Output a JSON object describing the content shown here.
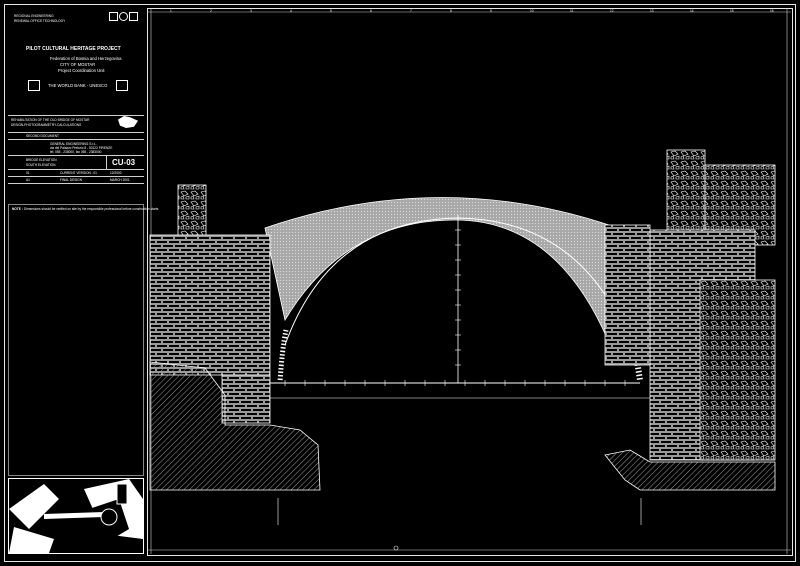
{
  "title_block": {
    "org_small_1": "REGIONAL ENGINEERING",
    "org_small_2": "RENEWAL OFFICE TECHNOLOGY",
    "project_title": "PILOT CULTURAL HERITAGE PROJECT",
    "federation": "Federation of Bosnia and Herzegovina",
    "city": "CITY OF MOSTAR",
    "unit": "Project Coordination Unit",
    "sponsor": "THE WORLD BANK - UNESCO",
    "rehab_line1": "REHABILITATION OF THE OLD BRIDGE OF MOSTAR",
    "rehab_line2": "DESIGN-PHOTOGRAMMETRY-CALCULATIONS",
    "second_document": "SECOND DOCUMENT",
    "engineer_line1": "GENERAL ENGINEERING S.r.L.",
    "engineer_line2": "via del Palazzo Pretorio 8 - 50122 FIRENZE",
    "engineer_line3": "tel. 055 - 238000, fax 055 - 2383000",
    "drawing_title_1": "BRIDGE ELEVATION",
    "drawing_title_2": "SOUTH ELEVATION",
    "drawing_code": "CU-03",
    "row1": [
      "01",
      "CURRENT VERSION : 01",
      "12/2000"
    ],
    "row2": [
      "A1",
      "FINAL DESIGN",
      "MARCH 2001"
    ],
    "notes_label": "NOTE :",
    "notes_text": "Dimensions should be verified on site by the responsible professional before construction starts"
  },
  "scale_numbers": {
    "top": [
      "1",
      "2",
      "3",
      "4",
      "5",
      "6",
      "7",
      "8",
      "9",
      "10",
      "11",
      "12",
      "13",
      "14",
      "15",
      "16"
    ],
    "left": [
      "A",
      "B",
      "C",
      "D",
      "E",
      "F",
      "G",
      "H",
      "I",
      "J",
      "K",
      "L"
    ]
  },
  "colors": {
    "background": "#000000",
    "line": "#ffffff",
    "hatch": "#9a9a9a"
  },
  "icons": [
    "logo-icon",
    "unesco-icon",
    "bosnia-map-icon"
  ]
}
